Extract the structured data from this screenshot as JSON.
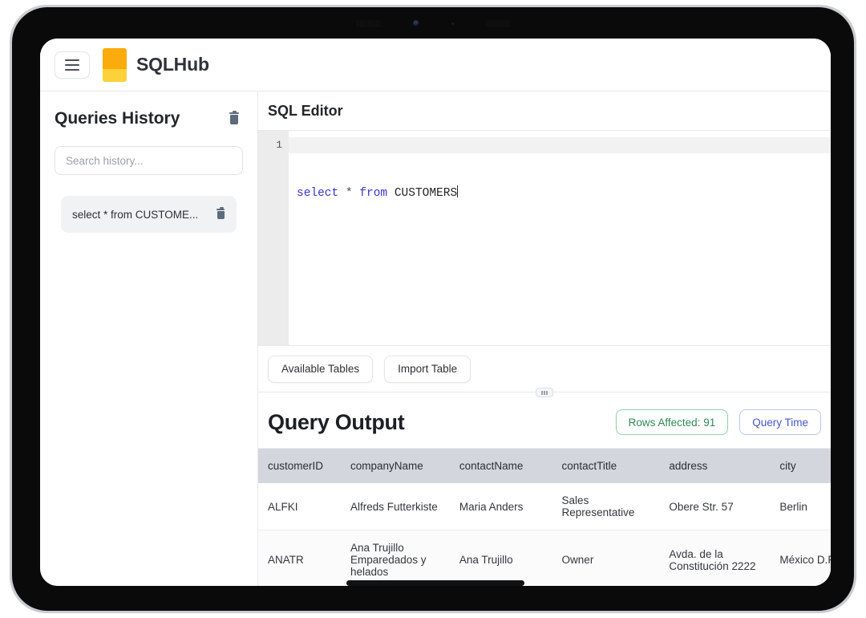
{
  "app": {
    "name": "SQLHub",
    "menu_icon": "hamburger-icon",
    "logo_colors": {
      "top": "#fbab0b",
      "bottom": "#fdd13a"
    }
  },
  "sidebar": {
    "title": "Queries History",
    "clear_all_icon": "trash-icon",
    "search": {
      "placeholder": "Search history...",
      "value": ""
    },
    "history_items": [
      {
        "label": "select * from CUSTOME...",
        "delete_icon": "trash-icon"
      }
    ]
  },
  "editor": {
    "title": "SQL Editor",
    "line_number": "1",
    "tokens": {
      "keyword1": "select",
      "operator": "*",
      "keyword2": "from",
      "identifier": "CUSTOMERS"
    },
    "full_query": "select * from CUSTOMERS",
    "toolbar": {
      "available_tables_label": "Available Tables",
      "import_table_label": "Import Table"
    },
    "resize_handle": "drag-grip-icon"
  },
  "output": {
    "title": "Query Output",
    "badges": {
      "rows_affected": "Rows Affected: 91",
      "query_time": "Query Time",
      "rows_color": "#2f8a55",
      "time_color": "#4458c9"
    },
    "columns": [
      "customerID",
      "companyName",
      "contactName",
      "contactTitle",
      "address",
      "city",
      "",
      ""
    ],
    "rows": [
      {
        "customerID": "ALFKI",
        "companyName": "Alfreds Futterkiste",
        "contactName": "Maria Anders",
        "contactTitle": "Sales Representative",
        "address": "Obere Str. 57",
        "city": "Berlin",
        "col6": "",
        "col7": ""
      },
      {
        "customerID": "ANATR",
        "companyName": "Ana Trujillo Emparedados y helados",
        "contactName": "Ana Trujillo",
        "contactTitle": "Owner",
        "address": "Avda. de la Constitución 2222",
        "city": "México D.F.",
        "col6": "",
        "col7": ""
      }
    ]
  }
}
